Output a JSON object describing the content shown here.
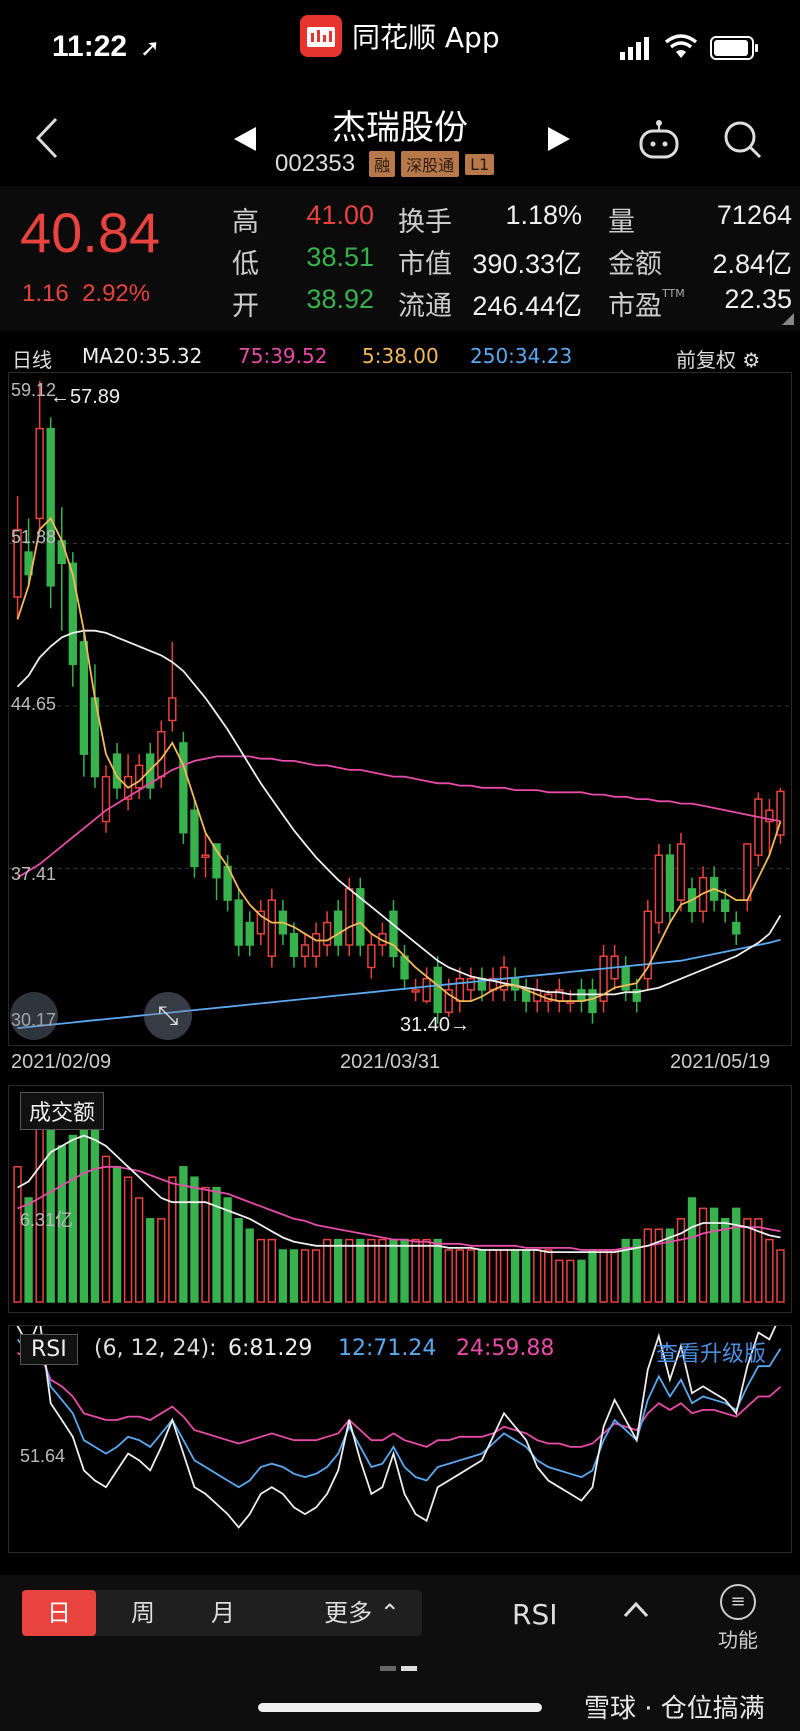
{
  "status_bar": {
    "time": "11:22",
    "app_name": "同花顺 App"
  },
  "header": {
    "stock_name": "杰瑞股份",
    "stock_code": "002353",
    "tags": [
      "融",
      "深股通",
      "L1"
    ]
  },
  "quote": {
    "price": "40.84",
    "change": "1.16",
    "change_pct": "2.92%",
    "fields": [
      {
        "label": "高",
        "value": "41.00",
        "color": "#e8433e"
      },
      {
        "label": "低",
        "value": "38.51",
        "color": "#37b24d"
      },
      {
        "label": "开",
        "value": "38.92",
        "color": "#37b24d"
      },
      {
        "label": "换手",
        "value": "1.18%",
        "color": "#eeeeee"
      },
      {
        "label": "市值",
        "value": "390.33亿",
        "color": "#eeeeee"
      },
      {
        "label": "流通",
        "value": "246.44亿",
        "color": "#eeeeee"
      },
      {
        "label": "量",
        "value": "71264",
        "color": "#eeeeee"
      },
      {
        "label": "金额",
        "value": "2.84亿",
        "color": "#eeeeee"
      },
      {
        "label": "市盈",
        "value": "22.35",
        "color": "#eeeeee",
        "superscript": "TTM"
      }
    ]
  },
  "ma_bar": {
    "period": "日线",
    "ma20": "MA20:35.32",
    "ma75": "75:39.52",
    "ma5": "5:38.00",
    "ma250": "250:34.23",
    "adjust": "前复权"
  },
  "kline": {
    "y_ticks": [
      "59.12",
      "51.88",
      "44.65",
      "37.41",
      "30.17"
    ],
    "max_annotation": "←57.89",
    "min_annotation": "31.40→",
    "dates": [
      "2021/02/09",
      "2021/03/31",
      "2021/05/19"
    ]
  },
  "volume": {
    "title": "成交额",
    "tick": "6.31亿"
  },
  "rsi": {
    "title": "RSI",
    "params": "(6, 12, 24):",
    "rsi6": "6:81.29",
    "rsi12": "12:71.24",
    "rsi24": "24:59.88",
    "upgrade": "查看升级版",
    "tick": "51.64"
  },
  "bottom_bar": {
    "tabs": [
      "日",
      "周",
      "月",
      "更多"
    ],
    "indicator": "RSI",
    "function_label": "功能",
    "watermark": "雪球 · 仓位搞满"
  },
  "colors": {
    "up": "#e8433e",
    "down": "#37b24d",
    "ma5": "#f5b95a",
    "ma20": "#eeeeee",
    "ma75": "#e84ba8",
    "ma250": "#5aa9f0",
    "rsi6": "#eeeeee",
    "rsi12": "#5aa9f0",
    "rsi24": "#e84ba8"
  },
  "chart_data": {
    "type": "candlestick",
    "ylim": [
      30.17,
      59.12
    ],
    "candles": [
      {
        "o": 49.5,
        "c": 52.5,
        "h": 54.0,
        "l": 48.5
      },
      {
        "o": 51.5,
        "c": 50.5,
        "h": 53.0,
        "l": 50.0
      },
      {
        "o": 53.0,
        "c": 57.0,
        "h": 59.12,
        "l": 52.5
      },
      {
        "o": 57.0,
        "c": 50.0,
        "h": 57.5,
        "l": 49.0
      },
      {
        "o": 52.0,
        "c": 51.0,
        "h": 53.5,
        "l": 48.0
      },
      {
        "o": 51.0,
        "c": 46.5,
        "h": 51.5,
        "l": 45.5
      },
      {
        "o": 47.5,
        "c": 42.5,
        "h": 48.0,
        "l": 41.5
      },
      {
        "o": 45.0,
        "c": 41.5,
        "h": 46.5,
        "l": 41.0
      },
      {
        "o": 39.5,
        "c": 41.5,
        "h": 42.0,
        "l": 39.0
      },
      {
        "o": 42.5,
        "c": 41.0,
        "h": 43.0,
        "l": 40.5
      },
      {
        "o": 40.5,
        "c": 41.5,
        "h": 42.5,
        "l": 40.0
      },
      {
        "o": 41.0,
        "c": 42.0,
        "h": 42.5,
        "l": 40.5
      },
      {
        "o": 42.5,
        "c": 41.0,
        "h": 43.0,
        "l": 40.5
      },
      {
        "o": 41.5,
        "c": 43.5,
        "h": 44.0,
        "l": 41.0
      },
      {
        "o": 44.0,
        "c": 45.0,
        "h": 47.5,
        "l": 43.5
      },
      {
        "o": 43.0,
        "c": 39.0,
        "h": 43.5,
        "l": 38.5
      },
      {
        "o": 40.0,
        "c": 37.5,
        "h": 40.5,
        "l": 37.0
      },
      {
        "o": 38.0,
        "c": 38.0,
        "h": 39.0,
        "l": 37.0
      },
      {
        "o": 38.5,
        "c": 37.0,
        "h": 38.5,
        "l": 36.0
      },
      {
        "o": 37.5,
        "c": 36.0,
        "h": 38.0,
        "l": 35.5
      },
      {
        "o": 36.0,
        "c": 34.0,
        "h": 36.5,
        "l": 33.5
      },
      {
        "o": 35.0,
        "c": 34.0,
        "h": 35.5,
        "l": 33.5
      },
      {
        "o": 34.5,
        "c": 35.5,
        "h": 36.0,
        "l": 34.0
      },
      {
        "o": 33.5,
        "c": 36.0,
        "h": 36.5,
        "l": 33.0
      },
      {
        "o": 35.5,
        "c": 34.5,
        "h": 36.0,
        "l": 34.0
      },
      {
        "o": 34.5,
        "c": 33.5,
        "h": 35.0,
        "l": 33.0
      },
      {
        "o": 33.5,
        "c": 34.0,
        "h": 34.5,
        "l": 33.0
      },
      {
        "o": 33.5,
        "c": 34.5,
        "h": 35.0,
        "l": 33.0
      },
      {
        "o": 34.0,
        "c": 35.0,
        "h": 35.5,
        "l": 33.5
      },
      {
        "o": 35.5,
        "c": 34.0,
        "h": 36.0,
        "l": 33.5
      },
      {
        "o": 34.0,
        "c": 36.5,
        "h": 37.0,
        "l": 33.5
      },
      {
        "o": 36.5,
        "c": 34.0,
        "h": 37.0,
        "l": 33.5
      },
      {
        "o": 33.0,
        "c": 34.0,
        "h": 34.5,
        "l": 32.5
      },
      {
        "o": 34.0,
        "c": 34.5,
        "h": 35.0,
        "l": 33.5
      },
      {
        "o": 35.5,
        "c": 33.5,
        "h": 36.0,
        "l": 33.0
      },
      {
        "o": 33.5,
        "c": 32.5,
        "h": 34.0,
        "l": 32.0
      },
      {
        "o": 32.0,
        "c": 32.0,
        "h": 32.5,
        "l": 31.5
      },
      {
        "o": 31.5,
        "c": 32.5,
        "h": 33.0,
        "l": 31.4
      },
      {
        "o": 33.0,
        "c": 31.0,
        "h": 33.5,
        "l": 30.5
      },
      {
        "o": 31.0,
        "c": 32.0,
        "h": 32.5,
        "l": 30.8
      },
      {
        "o": 31.5,
        "c": 32.5,
        "h": 33.0,
        "l": 31.0
      },
      {
        "o": 32.0,
        "c": 32.5,
        "h": 33.0,
        "l": 31.5
      },
      {
        "o": 32.5,
        "c": 32.0,
        "h": 33.0,
        "l": 31.5
      },
      {
        "o": 32.0,
        "c": 32.5,
        "h": 33.0,
        "l": 31.5
      },
      {
        "o": 32.0,
        "c": 33.0,
        "h": 33.5,
        "l": 31.5
      },
      {
        "o": 32.5,
        "c": 32.0,
        "h": 33.0,
        "l": 31.5
      },
      {
        "o": 32.0,
        "c": 31.5,
        "h": 32.5,
        "l": 31.0
      },
      {
        "o": 31.5,
        "c": 32.0,
        "h": 32.5,
        "l": 31.0
      },
      {
        "o": 31.5,
        "c": 31.8,
        "h": 32.0,
        "l": 31.0
      },
      {
        "o": 31.5,
        "c": 32.0,
        "h": 32.5,
        "l": 31.0
      },
      {
        "o": 31.5,
        "c": 31.5,
        "h": 32.0,
        "l": 31.0
      },
      {
        "o": 32.0,
        "c": 31.5,
        "h": 32.5,
        "l": 31.0
      },
      {
        "o": 32.0,
        "c": 31.0,
        "h": 32.5,
        "l": 30.5
      },
      {
        "o": 31.5,
        "c": 33.5,
        "h": 34.0,
        "l": 31.0
      },
      {
        "o": 32.5,
        "c": 33.5,
        "h": 34.0,
        "l": 32.0
      },
      {
        "o": 33.0,
        "c": 32.0,
        "h": 33.5,
        "l": 31.5
      },
      {
        "o": 32.0,
        "c": 31.5,
        "h": 32.5,
        "l": 31.0
      },
      {
        "o": 32.5,
        "c": 35.5,
        "h": 36.0,
        "l": 32.0
      },
      {
        "o": 35.0,
        "c": 38.0,
        "h": 38.5,
        "l": 34.5
      },
      {
        "o": 38.0,
        "c": 35.5,
        "h": 38.5,
        "l": 35.0
      },
      {
        "o": 36.0,
        "c": 38.5,
        "h": 39.0,
        "l": 35.5
      },
      {
        "o": 36.5,
        "c": 35.5,
        "h": 37.0,
        "l": 35.0
      },
      {
        "o": 35.5,
        "c": 37.0,
        "h": 37.5,
        "l": 35.0
      },
      {
        "o": 37.0,
        "c": 36.0,
        "h": 37.5,
        "l": 35.5
      },
      {
        "o": 36.0,
        "c": 35.5,
        "h": 36.5,
        "l": 35.0
      },
      {
        "o": 35.0,
        "c": 34.5,
        "h": 35.5,
        "l": 34.0
      },
      {
        "o": 36.0,
        "c": 38.5,
        "h": 38.5,
        "l": 35.5
      },
      {
        "o": 38.0,
        "c": 40.5,
        "h": 40.8,
        "l": 37.5
      },
      {
        "o": 39.5,
        "c": 40.0,
        "h": 40.5,
        "l": 38.0
      },
      {
        "o": 38.9,
        "c": 40.84,
        "h": 41.0,
        "l": 38.51
      }
    ],
    "ma5": [
      48.5,
      50.0,
      52.5,
      53.0,
      52.0,
      50.5,
      48.0,
      45.0,
      42.5,
      41.5,
      41.0,
      41.3,
      41.8,
      42.3,
      43.0,
      42.0,
      40.5,
      39.0,
      38.2,
      37.5,
      36.5,
      35.8,
      35.3,
      35.0,
      35.0,
      34.8,
      34.5,
      34.2,
      34.2,
      34.5,
      34.8,
      35.0,
      34.5,
      34.2,
      34.0,
      33.5,
      33.0,
      32.6,
      32.2,
      31.8,
      31.5,
      31.5,
      31.7,
      32.0,
      32.2,
      32.2,
      32.0,
      31.8,
      31.6,
      31.5,
      31.5,
      31.5,
      31.6,
      31.8,
      32.1,
      32.2,
      32.3,
      33.0,
      34.0,
      35.0,
      35.8,
      36.0,
      36.3,
      36.5,
      36.3,
      36.0,
      36.0,
      37.0,
      38.0,
      39.5
    ],
    "ma20": [
      45.5,
      46.0,
      46.8,
      47.3,
      47.7,
      47.9,
      48.0,
      48.0,
      47.9,
      47.7,
      47.5,
      47.3,
      47.1,
      46.9,
      46.6,
      46.2,
      45.6,
      45.0,
      44.3,
      43.6,
      42.8,
      42.0,
      41.2,
      40.5,
      39.8,
      39.1,
      38.5,
      37.9,
      37.4,
      36.9,
      36.5,
      36.1,
      35.7,
      35.3,
      34.9,
      34.5,
      34.1,
      33.7,
      33.3,
      33.0,
      32.8,
      32.6,
      32.5,
      32.4,
      32.3,
      32.2,
      32.1,
      32.0,
      31.9,
      31.9,
      31.8,
      31.8,
      31.8,
      31.8,
      31.8,
      31.9,
      31.9,
      32.0,
      32.1,
      32.3,
      32.5,
      32.7,
      32.9,
      33.1,
      33.3,
      33.5,
      33.8,
      34.1,
      34.5,
      35.32
    ],
    "ma75": [
      37.0,
      37.3,
      37.6,
      38.0,
      38.4,
      38.8,
      39.2,
      39.6,
      40.0,
      40.3,
      40.6,
      40.9,
      41.2,
      41.5,
      41.8,
      42.0,
      42.2,
      42.3,
      42.4,
      42.4,
      42.4,
      42.4,
      42.3,
      42.3,
      42.2,
      42.2,
      42.1,
      42.0,
      42.0,
      41.9,
      41.8,
      41.8,
      41.7,
      41.6,
      41.5,
      41.5,
      41.4,
      41.3,
      41.2,
      41.2,
      41.1,
      41.1,
      41.0,
      41.0,
      41.0,
      40.9,
      40.9,
      40.9,
      40.8,
      40.8,
      40.8,
      40.8,
      40.7,
      40.7,
      40.6,
      40.6,
      40.5,
      40.5,
      40.4,
      40.4,
      40.3,
      40.3,
      40.2,
      40.1,
      40.0,
      39.9,
      39.8,
      39.7,
      39.6,
      39.52
    ],
    "ma250": [
      30.3,
      30.35,
      30.4,
      30.45,
      30.5,
      30.55,
      30.6,
      30.65,
      30.7,
      30.75,
      30.8,
      30.85,
      30.9,
      30.95,
      31.0,
      31.05,
      31.1,
      31.15,
      31.2,
      31.25,
      31.3,
      31.35,
      31.4,
      31.45,
      31.5,
      31.55,
      31.6,
      31.65,
      31.7,
      31.75,
      31.8,
      31.85,
      31.9,
      31.95,
      32.0,
      32.05,
      32.1,
      32.15,
      32.2,
      32.25,
      32.3,
      32.35,
      32.4,
      32.45,
      32.5,
      32.55,
      32.6,
      32.65,
      32.7,
      32.75,
      32.8,
      32.85,
      32.9,
      32.95,
      33.0,
      33.05,
      33.1,
      33.15,
      33.2,
      33.25,
      33.3,
      33.4,
      33.5,
      33.6,
      33.7,
      33.8,
      33.9,
      34.0,
      34.1,
      34.23
    ],
    "volume": [
      6.5,
      5.0,
      9.0,
      9.5,
      7.5,
      8.0,
      9.5,
      9.0,
      7.0,
      6.5,
      6.0,
      5.0,
      4.0,
      4.0,
      6.0,
      6.5,
      6.0,
      5.5,
      5.5,
      5.0,
      4.0,
      3.5,
      3.0,
      3.0,
      2.5,
      2.5,
      2.5,
      2.5,
      3.0,
      3.0,
      3.0,
      3.0,
      3.0,
      3.0,
      3.0,
      3.0,
      3.0,
      3.0,
      3.0,
      2.5,
      2.5,
      2.5,
      2.5,
      2.5,
      2.5,
      2.5,
      2.5,
      2.5,
      2.5,
      2.0,
      2.0,
      2.0,
      2.5,
      2.5,
      2.5,
      3.0,
      3.0,
      3.5,
      3.5,
      3.5,
      4.0,
      5.0,
      4.5,
      4.5,
      4.0,
      4.5,
      4.0,
      4.0,
      3.0,
      2.5
    ],
    "vol_ma1": [
      5.5,
      5.8,
      6.5,
      7.2,
      7.5,
      7.8,
      8.0,
      7.8,
      7.5,
      7.0,
      6.5,
      6.0,
      5.5,
      5.0,
      4.8,
      4.8,
      4.8,
      4.8,
      4.6,
      4.4,
      4.2,
      4.0,
      3.7,
      3.4,
      3.1,
      2.9,
      2.8,
      2.7,
      2.7,
      2.7,
      2.7,
      2.7,
      2.7,
      2.7,
      2.7,
      2.7,
      2.7,
      2.7,
      2.7,
      2.6,
      2.6,
      2.6,
      2.5,
      2.5,
      2.5,
      2.5,
      2.5,
      2.5,
      2.4,
      2.4,
      2.4,
      2.4,
      2.4,
      2.4,
      2.4,
      2.5,
      2.6,
      2.7,
      2.9,
      3.1,
      3.3,
      3.6,
      3.8,
      3.8,
      3.8,
      3.7,
      3.6,
      3.4,
      3.2,
      3.1
    ],
    "vol_ma2": [
      4.5,
      4.7,
      5.0,
      5.3,
      5.6,
      5.9,
      6.2,
      6.4,
      6.5,
      6.5,
      6.4,
      6.3,
      6.1,
      5.9,
      5.7,
      5.6,
      5.5,
      5.4,
      5.3,
      5.2,
      5.0,
      4.8,
      4.6,
      4.4,
      4.2,
      4.0,
      3.9,
      3.7,
      3.6,
      3.5,
      3.4,
      3.3,
      3.2,
      3.1,
      3.0,
      3.0,
      2.9,
      2.9,
      2.8,
      2.8,
      2.8,
      2.7,
      2.7,
      2.7,
      2.7,
      2.7,
      2.6,
      2.6,
      2.6,
      2.6,
      2.6,
      2.5,
      2.5,
      2.5,
      2.5,
      2.6,
      2.6,
      2.7,
      2.8,
      2.9,
      3.0,
      3.1,
      3.3,
      3.4,
      3.5,
      3.6,
      3.6,
      3.6,
      3.5,
      3.4
    ],
    "rsi6": [
      78,
      72,
      80,
      55,
      50,
      45,
      35,
      32,
      30,
      35,
      40,
      38,
      35,
      42,
      50,
      40,
      30,
      28,
      25,
      22,
      18,
      22,
      28,
      30,
      28,
      24,
      22,
      24,
      28,
      35,
      50,
      38,
      28,
      30,
      40,
      28,
      22,
      20,
      30,
      32,
      34,
      36,
      38,
      45,
      52,
      48,
      44,
      36,
      32,
      30,
      28,
      26,
      30,
      48,
      56,
      50,
      44,
      65,
      75,
      62,
      72,
      58,
      60,
      58,
      56,
      52,
      66,
      76,
      74,
      81.29
    ],
    "rsi12": [
      74,
      70,
      74,
      60,
      56,
      52,
      44,
      42,
      40,
      42,
      45,
      44,
      42,
      46,
      50,
      44,
      38,
      36,
      34,
      32,
      30,
      32,
      36,
      37,
      36,
      34,
      33,
      34,
      36,
      40,
      48,
      42,
      36,
      37,
      42,
      36,
      33,
      32,
      36,
      37,
      38,
      39,
      40,
      43,
      46,
      44,
      42,
      38,
      36,
      35,
      34,
      33,
      35,
      44,
      50,
      47,
      44,
      56,
      63,
      57,
      62,
      55,
      57,
      56,
      55,
      53,
      60,
      66,
      66,
      71.24
    ],
    "rsi24": [
      70,
      68,
      70,
      62,
      60,
      57,
      52,
      51,
      50,
      50,
      51,
      51,
      50,
      52,
      54,
      51,
      47,
      46,
      45,
      44,
      43,
      44,
      45,
      46,
      45,
      44,
      44,
      44,
      45,
      46,
      50,
      47,
      44,
      44,
      46,
      44,
      43,
      42,
      44,
      44,
      45,
      45,
      45,
      46,
      48,
      47,
      46,
      44,
      43,
      43,
      42,
      42,
      43,
      46,
      49,
      48,
      47,
      52,
      55,
      53,
      55,
      52,
      53,
      53,
      52,
      51,
      54,
      57,
      57,
      59.88
    ]
  }
}
